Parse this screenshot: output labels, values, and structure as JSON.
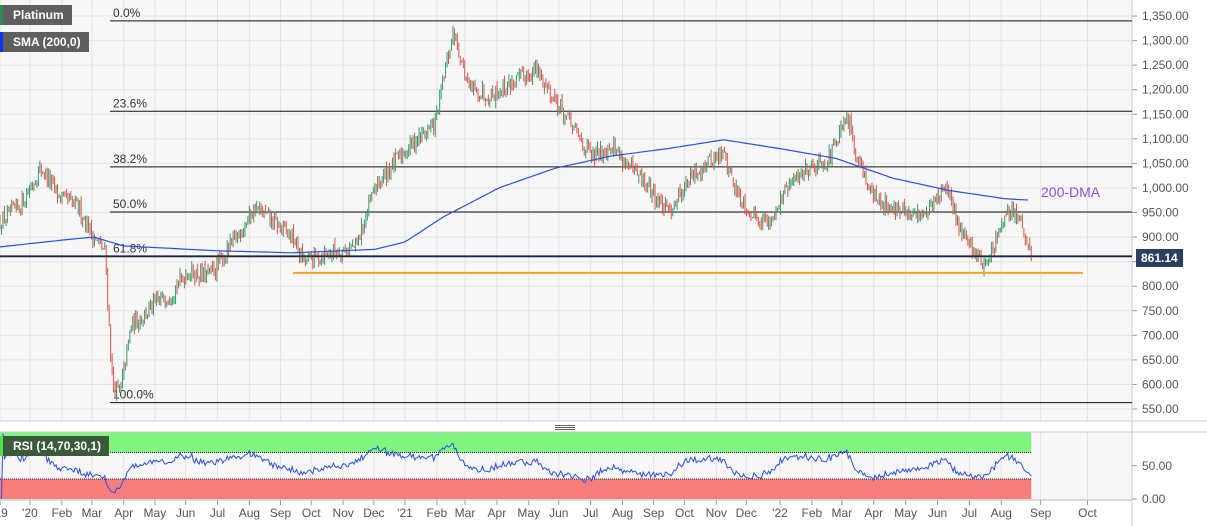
{
  "legend": {
    "instrument": "Platinum",
    "indicator": "SMA (200,0)",
    "rsi": "RSI (14,70,30,1)"
  },
  "current_price_label": "861.14",
  "annotation": "200-DMA",
  "colors": {
    "up": "#3a9a6a",
    "down": "#e0524a",
    "sma": "#2b4fe0",
    "support": "#f5a623",
    "rsi_line": "#2b4fe0",
    "overbought": "#80f580",
    "oversold": "#f87e7e",
    "price_tag": "#2a3f5f",
    "annotation": "#8a52d8"
  },
  "chart_data": [
    {
      "type": "candlestick",
      "title": "Platinum daily",
      "ylim": [
        530,
        1370
      ],
      "yticks": [
        "1,350.00",
        "1,300.00",
        "1,250.00",
        "1,200.00",
        "1,150.00",
        "1,100.00",
        "1,050.00",
        "1,000.00",
        "950.00",
        "900.00",
        "850.00",
        "800.00",
        "750.00",
        "700.00",
        "650.00",
        "600.00",
        "550.00"
      ],
      "ytick_values": [
        1350,
        1300,
        1250,
        1200,
        1150,
        1100,
        1050,
        1000,
        950,
        900,
        850,
        800,
        750,
        700,
        650,
        600,
        550
      ],
      "xticks": [
        {
          "label": "'19",
          "t": 2019.92
        },
        {
          "label": "'20",
          "t": 2020.0
        },
        {
          "label": "Feb",
          "t": 2020.085
        },
        {
          "label": "Mar",
          "t": 2020.165
        },
        {
          "label": "Apr",
          "t": 2020.25
        },
        {
          "label": "May",
          "t": 2020.333
        },
        {
          "label": "Jun",
          "t": 2020.415
        },
        {
          "label": "Jul",
          "t": 2020.5
        },
        {
          "label": "Aug",
          "t": 2020.585
        },
        {
          "label": "Sep",
          "t": 2020.668
        },
        {
          "label": "Oct",
          "t": 2020.75
        },
        {
          "label": "Nov",
          "t": 2020.835
        },
        {
          "label": "Dec",
          "t": 2020.917
        },
        {
          "label": "'21",
          "t": 2021.0
        },
        {
          "label": "Feb",
          "t": 2021.085
        },
        {
          "label": "Mar",
          "t": 2021.16
        },
        {
          "label": "Apr",
          "t": 2021.245
        },
        {
          "label": "May",
          "t": 2021.33
        },
        {
          "label": "Jun",
          "t": 2021.41
        },
        {
          "label": "Jul",
          "t": 2021.495
        },
        {
          "label": "Aug",
          "t": 2021.58
        },
        {
          "label": "Sep",
          "t": 2021.663
        },
        {
          "label": "Oct",
          "t": 2021.745
        },
        {
          "label": "Nov",
          "t": 2021.83
        },
        {
          "label": "Dec",
          "t": 2021.91
        },
        {
          "label": "'22",
          "t": 2022.0
        },
        {
          "label": "Feb",
          "t": 2022.085
        },
        {
          "label": "Mar",
          "t": 2022.165
        },
        {
          "label": "Apr",
          "t": 2022.25
        },
        {
          "label": "May",
          "t": 2022.335
        },
        {
          "label": "Jun",
          "t": 2022.42
        },
        {
          "label": "Jul",
          "t": 2022.505
        },
        {
          "label": "Aug",
          "t": 2022.59
        },
        {
          "label": "Sep",
          "t": 2022.695
        },
        {
          "label": "Oct",
          "t": 2022.82
        }
      ],
      "close_keypoints": [
        [
          2019.92,
          930
        ],
        [
          2019.97,
          960
        ],
        [
          2020.03,
          1040
        ],
        [
          2020.08,
          980
        ],
        [
          2020.13,
          960
        ],
        [
          2020.17,
          900
        ],
        [
          2020.2,
          870
        ],
        [
          2020.22,
          600
        ],
        [
          2020.24,
          580
        ],
        [
          2020.27,
          720
        ],
        [
          2020.33,
          760
        ],
        [
          2020.38,
          790
        ],
        [
          2020.42,
          830
        ],
        [
          2020.47,
          820
        ],
        [
          2020.5,
          840
        ],
        [
          2020.55,
          900
        ],
        [
          2020.6,
          960
        ],
        [
          2020.65,
          930
        ],
        [
          2020.7,
          900
        ],
        [
          2020.73,
          850
        ],
        [
          2020.8,
          870
        ],
        [
          2020.87,
          880
        ],
        [
          2020.92,
          1000
        ],
        [
          2020.97,
          1050
        ],
        [
          2021.03,
          1100
        ],
        [
          2021.08,
          1130
        ],
        [
          2021.11,
          1250
        ],
        [
          2021.13,
          1320
        ],
        [
          2021.17,
          1200
        ],
        [
          2021.23,
          1190
        ],
        [
          2021.3,
          1220
        ],
        [
          2021.35,
          1240
        ],
        [
          2021.4,
          1180
        ],
        [
          2021.45,
          1120
        ],
        [
          2021.5,
          1060
        ],
        [
          2021.55,
          1090
        ],
        [
          2021.6,
          1040
        ],
        [
          2021.65,
          1000
        ],
        [
          2021.7,
          950
        ],
        [
          2021.75,
          1010
        ],
        [
          2021.8,
          1050
        ],
        [
          2021.85,
          1070
        ],
        [
          2021.88,
          1000
        ],
        [
          2021.92,
          950
        ],
        [
          2021.97,
          930
        ],
        [
          2022.02,
          1000
        ],
        [
          2022.07,
          1040
        ],
        [
          2022.13,
          1060
        ],
        [
          2022.18,
          1140
        ],
        [
          2022.2,
          1080
        ],
        [
          2022.25,
          980
        ],
        [
          2022.3,
          960
        ],
        [
          2022.35,
          940
        ],
        [
          2022.4,
          960
        ],
        [
          2022.44,
          1000
        ],
        [
          2022.48,
          920
        ],
        [
          2022.52,
          870
        ],
        [
          2022.55,
          840
        ],
        [
          2022.58,
          900
        ],
        [
          2022.62,
          960
        ],
        [
          2022.64,
          930
        ],
        [
          2022.66,
          880
        ],
        [
          2022.67,
          861
        ]
      ],
      "sma200_keypoints": [
        [
          2019.92,
          880
        ],
        [
          2020.1,
          895
        ],
        [
          2020.17,
          900
        ],
        [
          2020.25,
          882
        ],
        [
          2020.5,
          872
        ],
        [
          2020.7,
          868
        ],
        [
          2020.92,
          875
        ],
        [
          2021.0,
          890
        ],
        [
          2021.1,
          940
        ],
        [
          2021.25,
          1000
        ],
        [
          2021.4,
          1040
        ],
        [
          2021.55,
          1065
        ],
        [
          2021.7,
          1080
        ],
        [
          2021.85,
          1098
        ],
        [
          2022.0,
          1080
        ],
        [
          2022.15,
          1060
        ],
        [
          2022.3,
          1020
        ],
        [
          2022.45,
          995
        ],
        [
          2022.6,
          978
        ],
        [
          2022.67,
          975
        ]
      ],
      "fibonacci": [
        {
          "label": "0.0%",
          "value": 1340
        },
        {
          "label": "23.6%",
          "value": 1156
        },
        {
          "label": "38.2%",
          "value": 1043
        },
        {
          "label": "50.0%",
          "value": 951
        },
        {
          "label": "61.8%",
          "value": 860
        },
        {
          "label": "100.0%",
          "value": 563
        }
      ],
      "support_level": 827,
      "last_price": 861.14
    },
    {
      "type": "line",
      "title": "RSI (14,70,30,1)",
      "ylim": [
        0,
        100
      ],
      "yticks": [
        "50.00",
        "0.00"
      ],
      "ytick_values": [
        50,
        0
      ],
      "overbought": 70,
      "oversold": 30,
      "period": 14
    }
  ]
}
